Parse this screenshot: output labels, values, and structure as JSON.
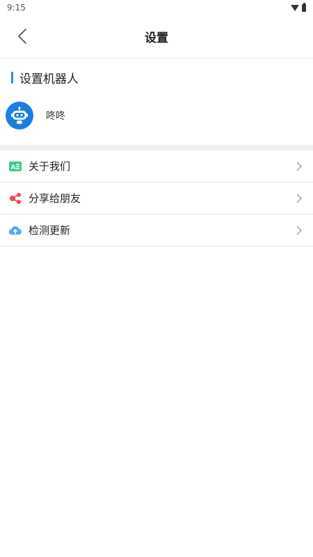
{
  "status_bar": {
    "time": "9:15"
  },
  "header": {
    "title": "设置"
  },
  "robot_section": {
    "title": "设置机器人",
    "robot_name": "咚咚"
  },
  "menu": [
    {
      "label": "关于我们",
      "icon": "about-icon"
    },
    {
      "label": "分享给朋友",
      "icon": "share-icon"
    },
    {
      "label": "检测更新",
      "icon": "cloud-upload-icon"
    }
  ],
  "colors": {
    "accent": "#2b8ce8",
    "avatar_bg": "#1a7fe0",
    "about_icon": "#3cc98b",
    "share_icon": "#f0484d",
    "update_icon": "#5aa6f0"
  }
}
